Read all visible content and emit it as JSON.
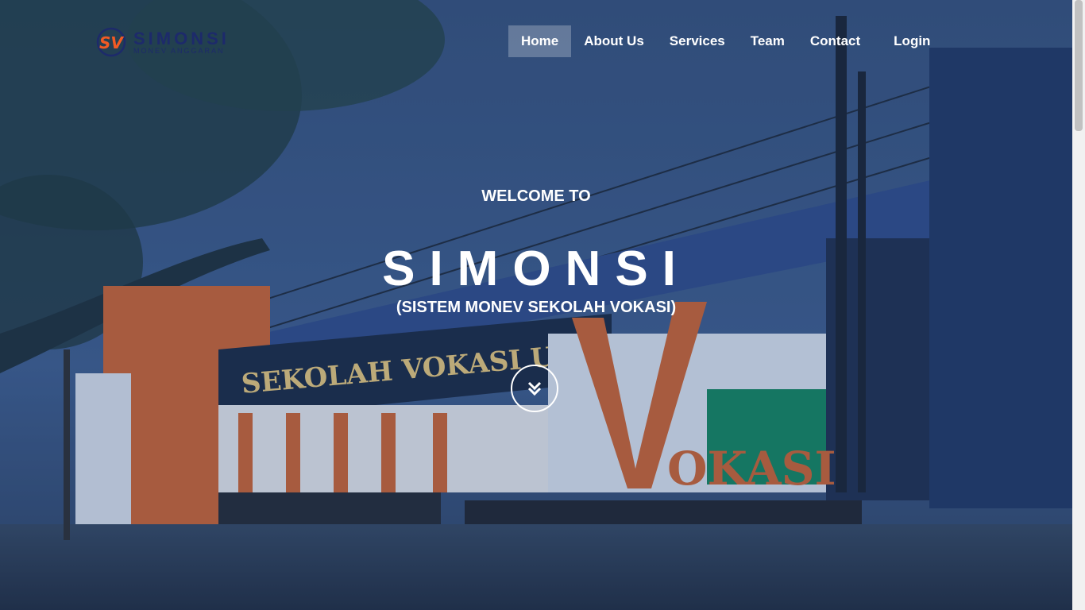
{
  "brand": {
    "name": "SIMONSI",
    "tagline": "MONEV ANGGARAN",
    "mark_letters": "SV",
    "colors": {
      "orange": "#f15a24",
      "navy": "#1d2a6b"
    }
  },
  "nav": {
    "items": [
      {
        "label": "Home",
        "active": true
      },
      {
        "label": "About Us"
      },
      {
        "label": "Services"
      },
      {
        "label": "Team"
      },
      {
        "label": "Contact"
      },
      {
        "label": "Login"
      }
    ]
  },
  "hero": {
    "welcome": "WELCOME TO",
    "title": "SIMONSI",
    "subtitle": "(SISTEM MONEV SEKOLAH VOKASI)",
    "scroll_icon": "double-chevron-down-icon"
  }
}
